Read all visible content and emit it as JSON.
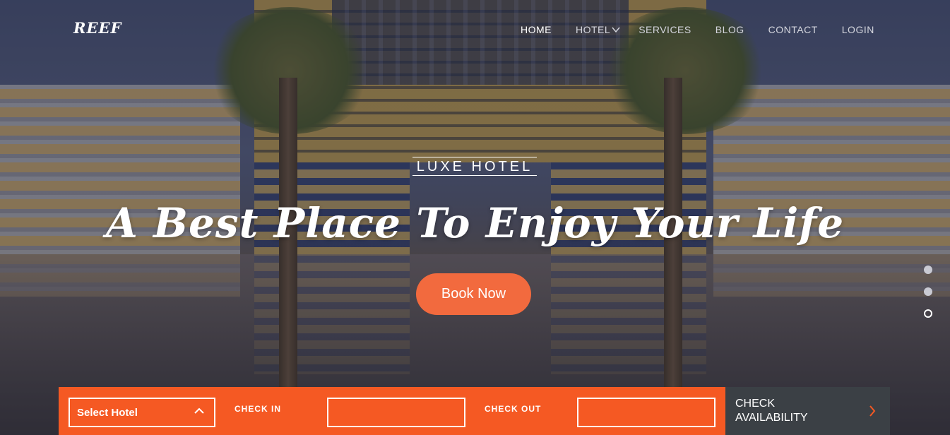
{
  "brand": {
    "logo": "REEF"
  },
  "nav": {
    "items": [
      {
        "label": "HOME",
        "active": true
      },
      {
        "label": "HOTEL",
        "active": false,
        "icon": "chevron-down-icon"
      },
      {
        "label": "SERVICES",
        "active": false
      },
      {
        "label": "BLOG",
        "active": false
      },
      {
        "label": "CONTACT",
        "active": false
      },
      {
        "label": "LOGIN",
        "active": false
      }
    ]
  },
  "hero": {
    "kicker": "LUXE HOTEL",
    "headline": "A Best Place To Enjoy Your Life",
    "cta_label": "Book Now",
    "slides": {
      "count": 3,
      "active_index": 2
    }
  },
  "booking": {
    "select_hotel": "Select Hotel",
    "select_icon": "chevron-up-icon",
    "check_in_label": "CHECK IN",
    "check_in_value": "",
    "check_out_label": "CHECK OUT",
    "check_out_value": "",
    "check_button_line1": "CHECK",
    "check_button_line2": "AVAILABILITY",
    "check_icon": "chevron-right-icon"
  },
  "colors": {
    "accent": "#f55923",
    "cta": "#f26a3e",
    "dark": "#3b4045"
  }
}
